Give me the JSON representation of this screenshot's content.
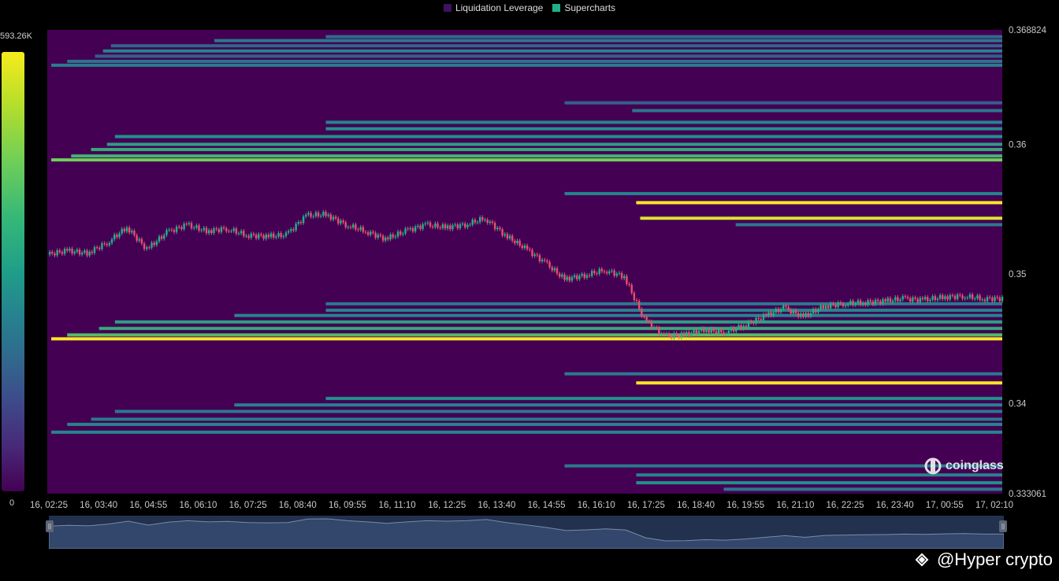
{
  "legend": [
    {
      "label": "Liquidation Leverage",
      "color": "#3d1260"
    },
    {
      "label": "Supercharts",
      "color": "#1fb28a"
    }
  ],
  "colorbar": {
    "max_label": "593.26K",
    "min_label": "0"
  },
  "watermark": {
    "text": "coinglass",
    "icon": "coinglass-logo-icon"
  },
  "credit": {
    "icon": "binance-square-icon",
    "text": "@Hyper crypto"
  },
  "chart_data": {
    "type": "heatmap",
    "title": "",
    "xlabel": "",
    "ylabel": "",
    "x_ticks": [
      "16, 02:25",
      "16, 03:40",
      "16, 04:55",
      "16, 06:10",
      "16, 07:25",
      "16, 08:40",
      "16, 09:55",
      "16, 11:10",
      "16, 12:25",
      "16, 13:40",
      "16, 14:55",
      "16, 16:10",
      "16, 17:25",
      "16, 18:40",
      "16, 19:55",
      "16, 21:10",
      "16, 22:25",
      "16, 23:40",
      "17, 00:55",
      "17, 02:10"
    ],
    "y_ticks": [
      "0.368824",
      "0.36",
      "0.35",
      "0.34",
      "0.333061"
    ],
    "ylim": [
      0.333061,
      0.368824
    ],
    "x_range_hours": [
      0,
      24.0
    ],
    "color_scale": {
      "min": 0,
      "max": 593260,
      "colormap": "viridis",
      "background": "#440154"
    },
    "grid": false,
    "legend_position": "top-center",
    "liquidation_bands": [
      {
        "price": 0.3683,
        "start_h": 7.0,
        "level": 0.35
      },
      {
        "price": 0.368,
        "start_h": 4.2,
        "level": 0.4
      },
      {
        "price": 0.3676,
        "start_h": 1.6,
        "level": 0.32
      },
      {
        "price": 0.3672,
        "start_h": 1.4,
        "level": 0.45
      },
      {
        "price": 0.3668,
        "start_h": 1.2,
        "level": 0.3
      },
      {
        "price": 0.3664,
        "start_h": 0.5,
        "level": 0.38
      },
      {
        "price": 0.3661,
        "start_h": 0.1,
        "level": 0.42
      },
      {
        "price": 0.3632,
        "start_h": 13.0,
        "level": 0.3
      },
      {
        "price": 0.3626,
        "start_h": 14.7,
        "level": 0.4
      },
      {
        "price": 0.3617,
        "start_h": 7.0,
        "level": 0.45
      },
      {
        "price": 0.3612,
        "start_h": 7.0,
        "level": 0.5
      },
      {
        "price": 0.3606,
        "start_h": 1.7,
        "level": 0.5
      },
      {
        "price": 0.36,
        "start_h": 1.5,
        "level": 0.55
      },
      {
        "price": 0.3596,
        "start_h": 1.1,
        "level": 0.6
      },
      {
        "price": 0.3591,
        "start_h": 0.6,
        "level": 0.65
      },
      {
        "price": 0.3588,
        "start_h": 0.1,
        "level": 0.78
      },
      {
        "price": 0.3562,
        "start_h": 13.0,
        "level": 0.45
      },
      {
        "price": 0.3555,
        "start_h": 14.8,
        "level": 1.0
      },
      {
        "price": 0.3543,
        "start_h": 14.9,
        "level": 0.95
      },
      {
        "price": 0.3538,
        "start_h": 17.3,
        "level": 0.4
      },
      {
        "price": 0.3477,
        "start_h": 7.0,
        "level": 0.4
      },
      {
        "price": 0.3472,
        "start_h": 7.0,
        "level": 0.45
      },
      {
        "price": 0.3468,
        "start_h": 4.7,
        "level": 0.45
      },
      {
        "price": 0.3463,
        "start_h": 1.7,
        "level": 0.55
      },
      {
        "price": 0.3458,
        "start_h": 1.3,
        "level": 0.6
      },
      {
        "price": 0.3453,
        "start_h": 0.5,
        "level": 0.7
      },
      {
        "price": 0.345,
        "start_h": 0.1,
        "level": 1.0
      },
      {
        "price": 0.3423,
        "start_h": 13.0,
        "level": 0.4
      },
      {
        "price": 0.3416,
        "start_h": 14.8,
        "level": 1.0
      },
      {
        "price": 0.3404,
        "start_h": 7.0,
        "level": 0.5
      },
      {
        "price": 0.3399,
        "start_h": 4.7,
        "level": 0.45
      },
      {
        "price": 0.3394,
        "start_h": 1.7,
        "level": 0.4
      },
      {
        "price": 0.3388,
        "start_h": 1.1,
        "level": 0.4
      },
      {
        "price": 0.3384,
        "start_h": 0.5,
        "level": 0.45
      },
      {
        "price": 0.3378,
        "start_h": 0.1,
        "level": 0.45
      },
      {
        "price": 0.3352,
        "start_h": 13.0,
        "level": 0.4
      },
      {
        "price": 0.3345,
        "start_h": 14.8,
        "level": 0.45
      },
      {
        "price": 0.3339,
        "start_h": 14.8,
        "level": 0.5
      },
      {
        "price": 0.3334,
        "start_h": 17.0,
        "level": 0.4
      }
    ],
    "price_series": {
      "name": "",
      "hours": [
        0,
        0.5,
        1,
        1.5,
        2,
        2.5,
        3,
        3.5,
        4,
        4.5,
        5,
        5.5,
        6,
        6.5,
        7,
        7.5,
        8,
        8.5,
        9,
        9.5,
        10,
        10.5,
        11,
        11.5,
        12,
        12.5,
        13,
        13.5,
        14,
        14.5,
        15,
        15.5,
        16,
        16.5,
        17,
        17.5,
        18,
        18.5,
        19,
        19.5,
        20,
        20.5,
        21,
        21.5,
        22,
        22.5,
        23,
        23.5,
        24
      ],
      "close": [
        0.3515,
        0.3518,
        0.3516,
        0.3524,
        0.3536,
        0.3519,
        0.3532,
        0.3538,
        0.3533,
        0.3535,
        0.353,
        0.3529,
        0.353,
        0.3545,
        0.3546,
        0.3538,
        0.3533,
        0.3527,
        0.3533,
        0.3538,
        0.3536,
        0.3538,
        0.3543,
        0.353,
        0.352,
        0.3509,
        0.3496,
        0.3499,
        0.3503,
        0.3498,
        0.3465,
        0.3452,
        0.3453,
        0.3457,
        0.3455,
        0.346,
        0.3467,
        0.3474,
        0.3467,
        0.3475,
        0.3477,
        0.3478,
        0.3479,
        0.3481,
        0.348,
        0.3482,
        0.3483,
        0.3481,
        0.3481
      ]
    }
  }
}
